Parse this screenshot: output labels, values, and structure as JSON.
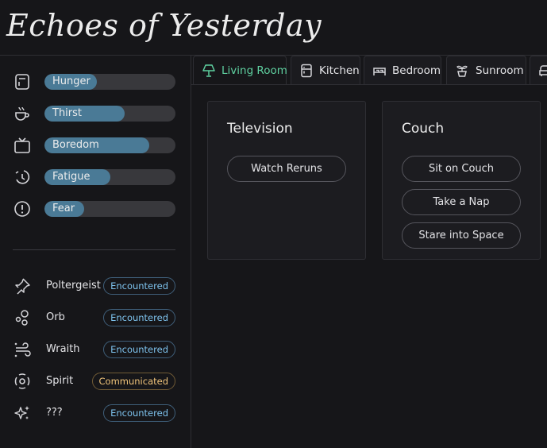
{
  "app": {
    "title": "Echoes of Yesterday"
  },
  "needs": [
    {
      "name": "Hunger",
      "icon": "fridge-icon",
      "level": 0.4
    },
    {
      "name": "Thirst",
      "icon": "coffee-icon",
      "level": 0.61
    },
    {
      "name": "Boredom",
      "icon": "tv-icon",
      "level": 0.8
    },
    {
      "name": "Fatigue",
      "icon": "moon-clock-icon",
      "level": 0.5
    },
    {
      "name": "Fear",
      "icon": "alert-circle-icon",
      "level": 0.3
    }
  ],
  "entities": [
    {
      "name": "Poltergeist",
      "icon": "pushpin-icon",
      "status": "Encountered"
    },
    {
      "name": "Orb",
      "icon": "orbs-icon",
      "status": "Encountered"
    },
    {
      "name": "Wraith",
      "icon": "wind-icon",
      "status": "Encountered"
    },
    {
      "name": "Spirit",
      "icon": "spirit-icon",
      "status": "Communicated"
    },
    {
      "name": "???",
      "icon": "sparkles-icon",
      "status": "Encountered"
    }
  ],
  "tabs": [
    {
      "label": "Living Room",
      "icon": "lamp-icon",
      "active": true
    },
    {
      "label": "Kitchen",
      "icon": "fridge-icon",
      "active": false
    },
    {
      "label": "Bedroom",
      "icon": "bed-icon",
      "active": false
    },
    {
      "label": "Sunroom",
      "icon": "plant-icon",
      "active": false
    }
  ],
  "cards": [
    {
      "title": "Television",
      "actions": [
        "Watch Reruns"
      ]
    },
    {
      "title": "Couch",
      "actions": [
        "Sit on Couch",
        "Take a Nap",
        "Stare into Space"
      ]
    }
  ],
  "colors": {
    "accent": "#5fd0a0",
    "bar_fill": "#4a7a96",
    "encountered": "#7ec3ee",
    "communicated": "#f0c47a"
  }
}
